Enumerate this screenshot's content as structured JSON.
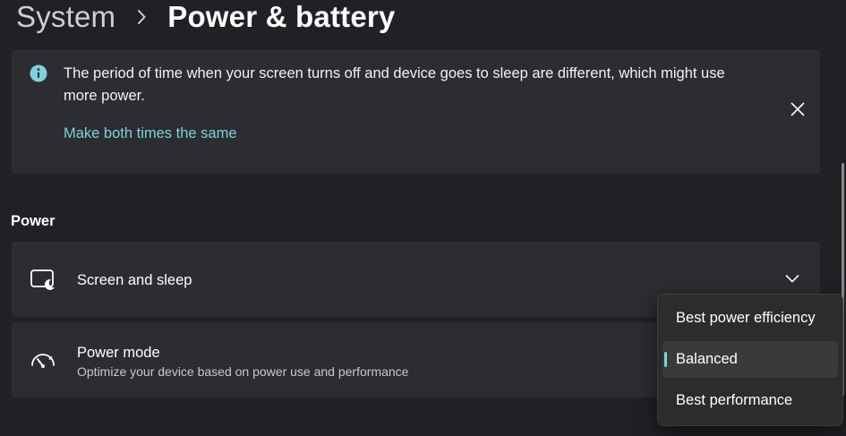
{
  "breadcrumb": {
    "parent": "System",
    "current": "Power & battery"
  },
  "banner": {
    "message": "The period of time when your screen turns off and device goes to sleep are different, which might use more power.",
    "link_label": "Make both times the same",
    "icon": "info-icon",
    "close_icon": "close-icon"
  },
  "power_section": {
    "heading": "Power",
    "screen_and_sleep": {
      "title": "Screen and sleep",
      "icon": "screen-sleep-icon"
    },
    "power_mode": {
      "title": "Power mode",
      "subtitle": "Optimize your device based on power use and performance",
      "icon": "speedometer-icon",
      "options": [
        "Best power efficiency",
        "Balanced",
        "Best performance"
      ],
      "selected": "Balanced"
    }
  },
  "colors": {
    "background": "#202124",
    "card": "#2b2d30",
    "accent": "#7fd1db",
    "flyout": "#2c2c2c"
  }
}
